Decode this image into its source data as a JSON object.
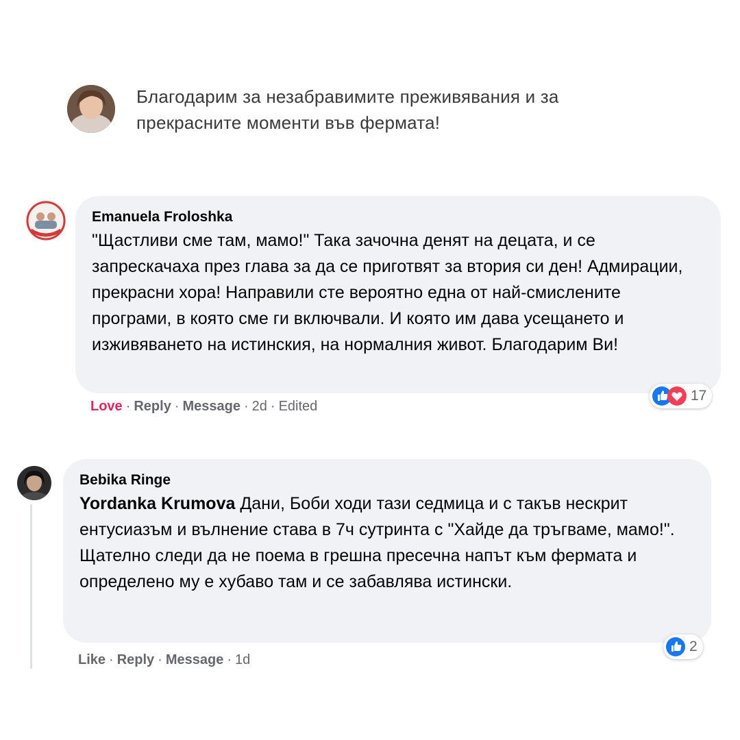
{
  "intro": {
    "text": "Благодарим за незабравимите преживявания и за прекрасните моменти във фермата!"
  },
  "comments": [
    {
      "author": "Emanuela Froloshka",
      "tag": "",
      "text": "\"Щастливи сме там, мамо!\" Така зачочна денят на децата, и се запрескачаха през глава за да се приготвят за втория си ден! Адмирации, прекрасни хора! Направили сте вероятно една от най-смислените програми, в която сме ги включвали. И която им дава усещането и изживяването на истинския, на нормалния живот. Благодарим Ви!",
      "actions": {
        "react": "Love",
        "reply": "Reply",
        "message": "Message",
        "time": "2d",
        "edited": "Edited"
      },
      "reactions": {
        "count": "17",
        "icons": [
          "like-icon",
          "love-icon"
        ]
      }
    },
    {
      "author": "Bebika Ringe",
      "tag": "Yordanka Krumova",
      "text": "Дани, Боби ходи тази седмица и с такъв нескрит ентусиазъм и вълнение става в 7ч сутринта с \"Хайде да тръгваме, мамо!\". Щателно следи да не поема в грешна пресечна напът към фермата и определено му е хубаво там и се забавлява истински.",
      "actions": {
        "react": "Like",
        "reply": "Reply",
        "message": "Message",
        "time": "1d"
      },
      "reactions": {
        "count": "2",
        "icons": [
          "like-icon"
        ]
      }
    }
  ],
  "colors": {
    "love": "#e0245e",
    "like": "#1877f2",
    "bubble": "#f0f2f5",
    "meta": "#65676b"
  }
}
